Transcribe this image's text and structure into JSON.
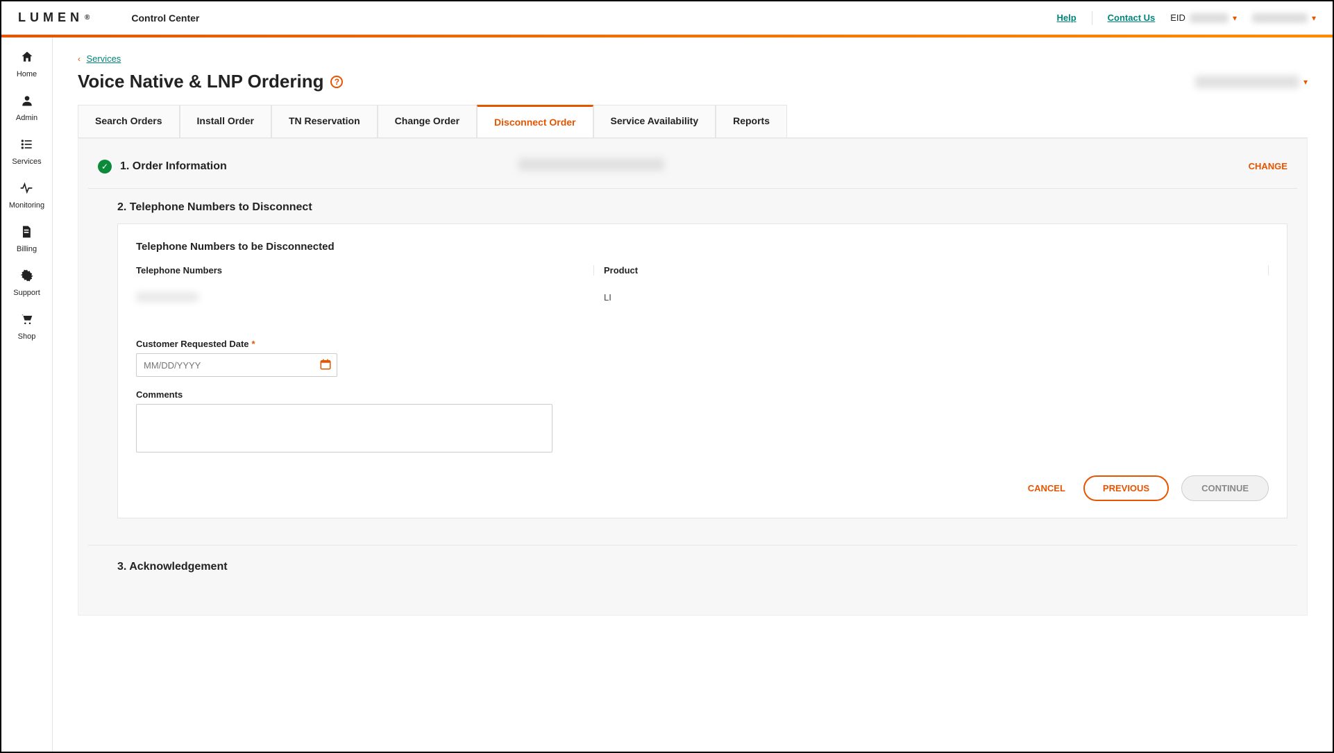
{
  "header": {
    "logo": "LUMEN",
    "logo_mark": "®",
    "app_name": "Control Center",
    "help_label": "Help",
    "contact_label": "Contact Us",
    "eid_prefix": "EID"
  },
  "sidebar": {
    "items": [
      {
        "key": "home",
        "label": "Home",
        "icon": "home"
      },
      {
        "key": "admin",
        "label": "Admin",
        "icon": "user"
      },
      {
        "key": "services",
        "label": "Services",
        "icon": "list"
      },
      {
        "key": "monitoring",
        "label": "Monitoring",
        "icon": "pulse"
      },
      {
        "key": "billing",
        "label": "Billing",
        "icon": "doc"
      },
      {
        "key": "support",
        "label": "Support",
        "icon": "gear"
      },
      {
        "key": "shop",
        "label": "Shop",
        "icon": "cart"
      }
    ]
  },
  "breadcrumb": {
    "label": "Services"
  },
  "page": {
    "title": "Voice Native & LNP Ordering",
    "help_tooltip": "?"
  },
  "tabs": {
    "items": [
      {
        "label": "Search Orders",
        "active": false
      },
      {
        "label": "Install Order",
        "active": false
      },
      {
        "label": "TN Reservation",
        "active": false
      },
      {
        "label": "Change Order",
        "active": false
      },
      {
        "label": "Disconnect Order",
        "active": true
      },
      {
        "label": "Service Availability",
        "active": false
      },
      {
        "label": "Reports",
        "active": false
      }
    ]
  },
  "wizard": {
    "step1": {
      "title": "1. Order Information",
      "change_label": "CHANGE"
    },
    "step2": {
      "title": "2. Telephone Numbers to Disconnect",
      "card_title": "Telephone Numbers to be Disconnected",
      "columns": {
        "tn": "Telephone Numbers",
        "product": "Product"
      },
      "rows": [
        {
          "tn": "redacted",
          "product": "LI"
        }
      ],
      "date_label": "Customer Requested Date",
      "date_placeholder": "MM/DD/YYYY",
      "comments_label": "Comments"
    },
    "step3": {
      "title": "3. Acknowledgement"
    },
    "actions": {
      "cancel": "CANCEL",
      "previous": "PREVIOUS",
      "continue": "CONTINUE"
    }
  }
}
